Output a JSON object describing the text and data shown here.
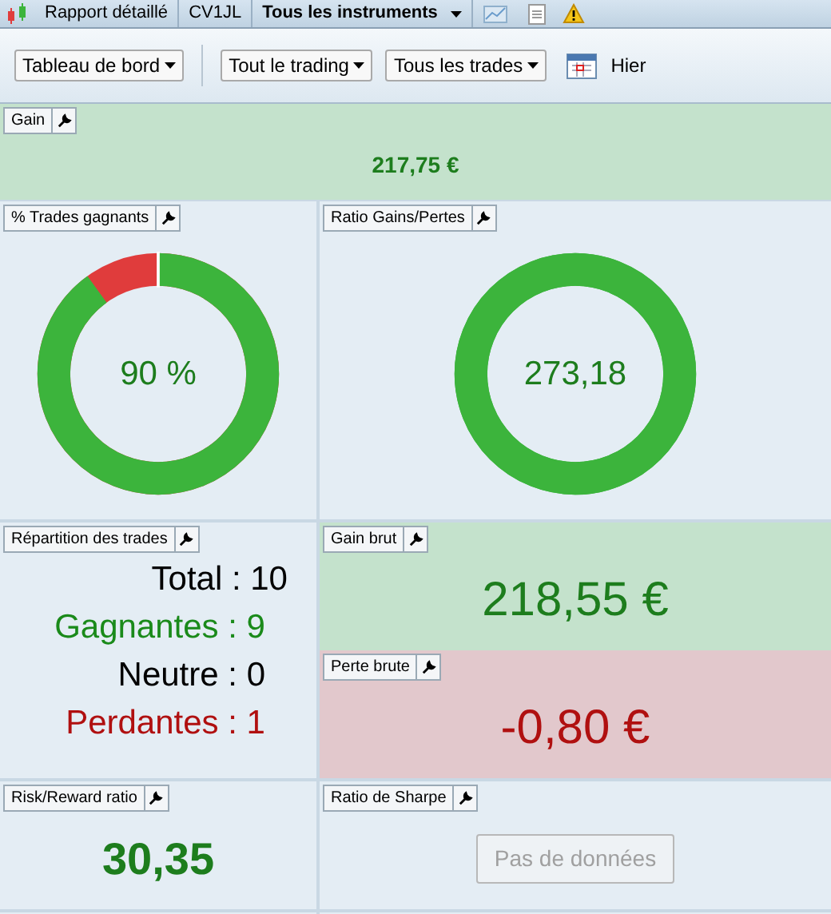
{
  "top_bar": {
    "items": [
      {
        "label": "Rapport détaillé",
        "bold": false,
        "dropdown": false
      },
      {
        "label": "CV1JL",
        "bold": false,
        "dropdown": false
      },
      {
        "label": "Tous les instruments",
        "bold": true,
        "dropdown": true
      }
    ]
  },
  "toolbar": {
    "dropdowns": [
      "Tableau de bord",
      "Tout le trading",
      "Tous les trades"
    ],
    "date_label": "Hier"
  },
  "gain": {
    "title": "Gain",
    "value": "217,75 €"
  },
  "win_rate": {
    "title": "% Trades gagnants",
    "value": "90 %",
    "kind": "split"
  },
  "gain_loss_ratio": {
    "title": "Ratio Gains/Pertes",
    "value": "273,18",
    "kind": "full"
  },
  "distribution": {
    "title": "Répartition des trades",
    "rows": [
      {
        "label": "Total : 10",
        "color": "#000000"
      },
      {
        "label": "Gagnantes : 9",
        "color": "#1a8a1a"
      },
      {
        "label": "Neutre : 0",
        "color": "#000000"
      },
      {
        "label": "Perdantes : 1",
        "color": "#b01010"
      }
    ]
  },
  "gross_gain": {
    "title": "Gain brut",
    "value": "218,55 €"
  },
  "gross_loss": {
    "title": "Perte brute",
    "value": "-0,80 €"
  },
  "risk_reward": {
    "title": "Risk/Reward ratio",
    "value": "30,35"
  },
  "sharpe": {
    "title": "Ratio de Sharpe",
    "button": "Pas de données",
    "disabled": true
  }
}
